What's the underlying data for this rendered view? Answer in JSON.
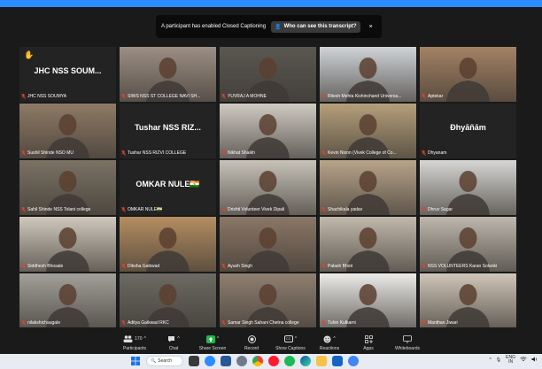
{
  "banner": {
    "message": "A participant has enabled Closed Captioning",
    "link": "Who can see this transcript?",
    "close": "×"
  },
  "tiles": [
    {
      "name": "JHC NSS SOUMYA",
      "big": "JHC NSS SOUM...",
      "raised_hand": true,
      "type": "text"
    },
    {
      "name": "SIWS NSS ST COLLEGE NAVI SH...",
      "type": "video",
      "bg": "#9c8f84"
    },
    {
      "name": "YUVRAJ A MOHNE",
      "type": "video",
      "bg": "#5a5751"
    },
    {
      "name": "Ritesh Mehta Kishinchand Universa...",
      "type": "video",
      "bg": "#cfd3d6"
    },
    {
      "name": "Aptekar",
      "type": "video",
      "bg": "#a48264"
    },
    {
      "name": "Sushil Shinde NSO MU",
      "type": "video",
      "bg": "#8e7a66",
      "active": true
    },
    {
      "name": "Tushar NSS RIZVI COLLEGE",
      "big": "Tushar NSS RIZ...",
      "type": "text"
    },
    {
      "name": "Nikhat Shaikh",
      "type": "video",
      "bg": "#cfcac2"
    },
    {
      "name": "Kevin Nixon (Vivek College of Co...",
      "type": "video",
      "bg": "#b59f7b"
    },
    {
      "name": "Dhyanam",
      "big": "Đhyāñām",
      "type": "text"
    },
    {
      "name": "Sahil Shinde NSS Tolani college",
      "type": "video",
      "bg": "#7b7264"
    },
    {
      "name": "OMKAR NULE🇮🇳",
      "big": "OMKAR NULE🇮🇳",
      "type": "text"
    },
    {
      "name": "Drishti Volunteer Vivek Dipali",
      "type": "video",
      "bg": "#c8c3b9"
    },
    {
      "name": "Shachikala yadav",
      "type": "video",
      "bg": "#b9a48a"
    },
    {
      "name": "Dhruv Sagar",
      "type": "video",
      "bg": "#d6d6d4"
    },
    {
      "name": "Siddhesh Bhosale",
      "type": "video",
      "bg": "#cfc9bd"
    },
    {
      "name": "Diksha Gaikwad",
      "type": "video",
      "bg": "#b58e62"
    },
    {
      "name": "Ayush Singh",
      "type": "video",
      "bg": "#8a7766"
    },
    {
      "name": "Palash Bhoir",
      "type": "video",
      "bg": "#c2b9ac"
    },
    {
      "name": "NSS VOLUNTEERS Karan Solanki",
      "type": "video",
      "bg": "#bdb7ad"
    },
    {
      "name": "nilakshichaugale",
      "type": "video",
      "bg": "#a3a099"
    },
    {
      "name": "Aditya Gaikwad RKC",
      "type": "video",
      "bg": "#6c6a63"
    },
    {
      "name": "Samar Singh Sahani Chetna college",
      "type": "video",
      "bg": "#8f7f70"
    },
    {
      "name": "Tuhin Kulkarni",
      "type": "video",
      "bg": "#ecebe9"
    },
    {
      "name": "Manthan Jiwari",
      "type": "video",
      "bg": "#cfc6b8"
    }
  ],
  "toolbar": {
    "participants_count": "170",
    "items": [
      {
        "label": "Participants",
        "icon": "participants-icon"
      },
      {
        "label": "Chat",
        "icon": "chat-icon"
      },
      {
        "label": "Share Screen",
        "icon": "share-screen-icon"
      },
      {
        "label": "Record",
        "icon": "record-icon"
      },
      {
        "label": "Show Captions",
        "icon": "captions-icon"
      },
      {
        "label": "Reactions",
        "icon": "reactions-icon"
      },
      {
        "label": "Apps",
        "icon": "apps-icon"
      },
      {
        "label": "Whiteboards",
        "icon": "whiteboard-icon"
      }
    ],
    "cc_short": "CC"
  },
  "taskbar": {
    "search_label": "Search",
    "lang": "ENG",
    "region": "IN"
  },
  "colors": {
    "accent": "#2d8cff",
    "active_speaker": "#c7e23b",
    "muted": "#e5412d",
    "share": "#23b54a"
  }
}
